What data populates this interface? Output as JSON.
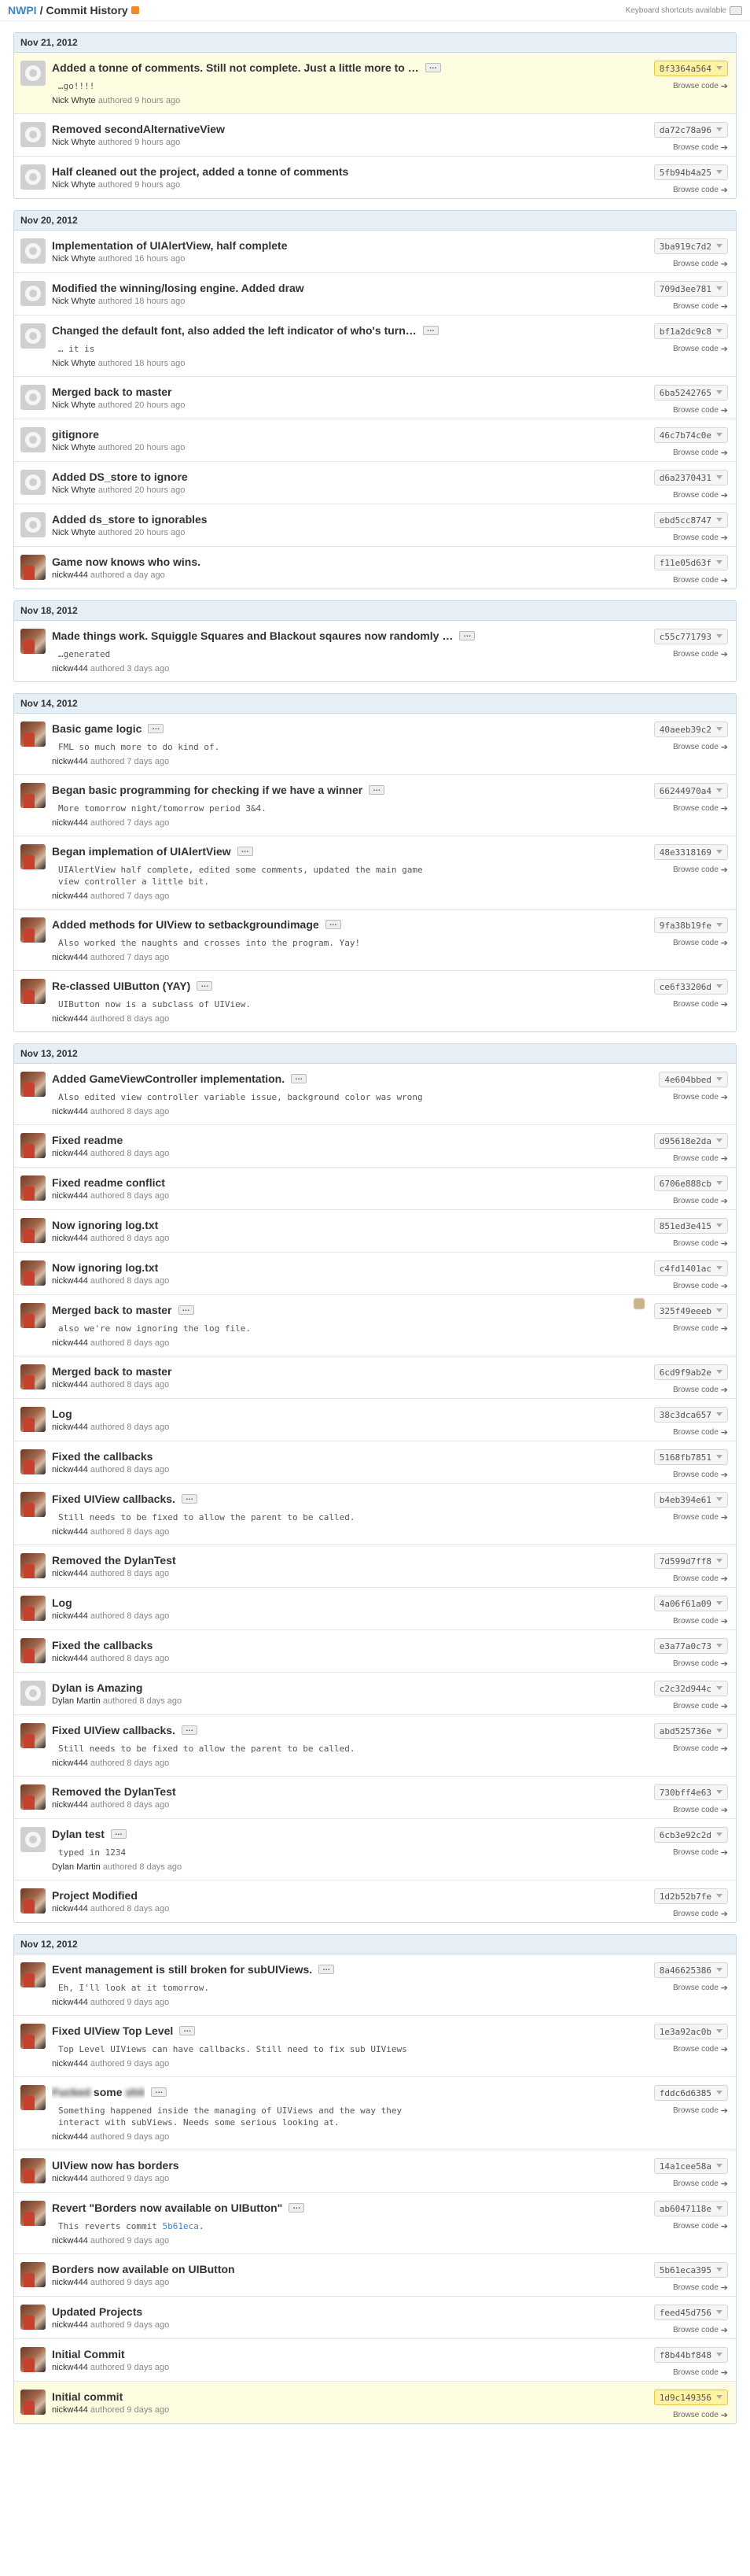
{
  "header": {
    "repo": "NWPI",
    "separator": " / ",
    "title": "Commit History",
    "shortcut_hint": "Keyboard shortcuts available",
    "rss_icon": "rss-icon",
    "keyboard_icon": "keyboard-icon"
  },
  "colors": {
    "link": "#4183c4",
    "header_bg": "#e6eff6",
    "highlight_bg": "#fffde1",
    "rss": "#f08a24"
  },
  "browse_label": "Browse code",
  "authored_label": "authored",
  "groups": [
    {
      "date": "Nov 21, 2012",
      "commits": [
        {
          "message": "Added a tonne of comments. Still not complete. Just a little more to …",
          "has_ellipsis": true,
          "description": "…go!!!!",
          "author": "Nick Whyte",
          "time": "9 hours ago",
          "sha": "8f3364a564",
          "avatar": "default",
          "highlighted": true
        },
        {
          "message": "Removed secondAlternativeView",
          "author": "Nick Whyte",
          "time": "9 hours ago",
          "sha": "da72c78a96",
          "avatar": "default"
        },
        {
          "message": "Half cleaned out the project, added a tonne of comments",
          "author": "Nick Whyte",
          "time": "9 hours ago",
          "sha": "5fb94b4a25",
          "avatar": "default"
        }
      ]
    },
    {
      "date": "Nov 20, 2012",
      "commits": [
        {
          "message": "Implementation of UIAlertView, half complete",
          "author": "Nick Whyte",
          "time": "16 hours ago",
          "sha": "3ba919c7d2",
          "avatar": "default"
        },
        {
          "message": "Modified the winning/losing engine. Added draw",
          "author": "Nick Whyte",
          "time": "18 hours ago",
          "sha": "709d3ee781",
          "avatar": "default"
        },
        {
          "message": "Changed the default font, also added the left indicator of who's turn…",
          "has_ellipsis": true,
          "description": "… it is",
          "author": "Nick Whyte",
          "time": "18 hours ago",
          "sha": "bf1a2dc9c8",
          "avatar": "default"
        },
        {
          "message": "Merged back to master",
          "author": "Nick Whyte",
          "time": "20 hours ago",
          "sha": "6ba5242765",
          "avatar": "default"
        },
        {
          "message": "gitignore",
          "author": "Nick Whyte",
          "time": "20 hours ago",
          "sha": "46c7b74c0e",
          "avatar": "default"
        },
        {
          "message": "Added DS_store to ignore",
          "author": "Nick Whyte",
          "time": "20 hours ago",
          "sha": "d6a2370431",
          "avatar": "default"
        },
        {
          "message": "Added ds_store to ignorables",
          "author": "Nick Whyte",
          "time": "20 hours ago",
          "sha": "ebd5cc8747",
          "avatar": "default"
        },
        {
          "message": "Game now knows who wins.",
          "author": "nickw444",
          "time": "a day ago",
          "sha": "f11e05d63f",
          "avatar": "custom"
        }
      ]
    },
    {
      "date": "Nov 18, 2012",
      "commits": [
        {
          "message": "Made things work. Squiggle Squares and Blackout sqaures now randomly …",
          "has_ellipsis": true,
          "description": "…generated",
          "author": "nickw444",
          "time": "3 days ago",
          "sha": "c55c771793",
          "avatar": "custom"
        }
      ]
    },
    {
      "date": "Nov 14, 2012",
      "commits": [
        {
          "message": "Basic game logic",
          "has_ellipsis": true,
          "description": "FML so much more to do kind of.",
          "author": "nickw444",
          "time": "7 days ago",
          "sha": "40aeeb39c2",
          "avatar": "custom"
        },
        {
          "message": "Began basic programming for checking if we have a winner",
          "has_ellipsis": true,
          "description": "More tomorrow night/tomorrow period 3&4.",
          "author": "nickw444",
          "time": "7 days ago",
          "sha": "66244970a4",
          "avatar": "custom"
        },
        {
          "message": "Began implemation of UIAlertView",
          "has_ellipsis": true,
          "description": "UIAlertView half complete, edited some comments, updated the main game\nview controller a little bit.",
          "author": "nickw444",
          "time": "7 days ago",
          "sha": "48e3318169",
          "avatar": "custom"
        },
        {
          "message": "Added methods for UIView to setbackgroundimage",
          "has_ellipsis": true,
          "description": "Also worked the naughts and crosses into the program. Yay!",
          "author": "nickw444",
          "time": "7 days ago",
          "sha": "9fa38b19fe",
          "avatar": "custom"
        },
        {
          "message": "Re-classed UIButton (YAY)",
          "has_ellipsis": true,
          "description": "UIButton now is a subclass of UIView.",
          "author": "nickw444",
          "time": "8 days ago",
          "sha": "ce6f33206d",
          "avatar": "custom"
        }
      ]
    },
    {
      "date": "Nov 13, 2012",
      "commits": [
        {
          "message": "Added GameViewController implementation.",
          "has_ellipsis": true,
          "description": "Also edited view controller variable issue, background color was wrong",
          "author": "nickw444",
          "time": "8 days ago",
          "sha": "4e604bbed",
          "avatar": "custom"
        },
        {
          "message": "Fixed readme",
          "author": "nickw444",
          "time": "8 days ago",
          "sha": "d95618e2da",
          "avatar": "custom"
        },
        {
          "message": "Fixed readme conflict",
          "author": "nickw444",
          "time": "8 days ago",
          "sha": "6706e888cb",
          "avatar": "custom"
        },
        {
          "message": "Now ignoring log.txt",
          "author": "nickw444",
          "time": "8 days ago",
          "sha": "851ed3e415",
          "avatar": "custom"
        },
        {
          "message": "Now ignoring log.txt",
          "author": "nickw444",
          "time": "8 days ago",
          "sha": "c4fd1401ac",
          "avatar": "custom"
        },
        {
          "message": "Merged back to master",
          "has_ellipsis": true,
          "description": "also we're now ignoring the log file.",
          "author": "nickw444",
          "time": "8 days ago",
          "sha": "325f49eeeb",
          "avatar": "custom",
          "blur_icon": true
        },
        {
          "message": "Merged back to master",
          "author": "nickw444",
          "time": "8 days ago",
          "sha": "6cd9f9ab2e",
          "avatar": "custom"
        },
        {
          "message": "Log",
          "author": "nickw444",
          "time": "8 days ago",
          "sha": "38c3dca657",
          "avatar": "custom"
        },
        {
          "message": "Fixed the callbacks",
          "author": "nickw444",
          "time": "8 days ago",
          "sha": "5168fb7851",
          "avatar": "custom"
        },
        {
          "message": "Fixed UIView callbacks.",
          "has_ellipsis": true,
          "description": "Still needs to be fixed to allow the parent to be called.",
          "author": "nickw444",
          "time": "8 days ago",
          "sha": "b4eb394e61",
          "avatar": "custom"
        },
        {
          "message": "Removed the DylanTest",
          "author": "nickw444",
          "time": "8 days ago",
          "sha": "7d599d7ff8",
          "avatar": "custom"
        },
        {
          "message": "Log",
          "author": "nickw444",
          "time": "8 days ago",
          "sha": "4a06f61a09",
          "avatar": "custom"
        },
        {
          "message": "Fixed the callbacks",
          "author": "nickw444",
          "time": "8 days ago",
          "sha": "e3a77a0c73",
          "avatar": "custom"
        },
        {
          "message": "Dylan is Amazing",
          "author": "Dylan Martin",
          "time": "8 days ago",
          "sha": "c2c32d944c",
          "avatar": "default"
        },
        {
          "message": "Fixed UIView callbacks.",
          "has_ellipsis": true,
          "description": "Still needs to be fixed to allow the parent to be called.",
          "author": "nickw444",
          "time": "8 days ago",
          "sha": "abd525736e",
          "avatar": "custom"
        },
        {
          "message": "Removed the DylanTest",
          "author": "nickw444",
          "time": "8 days ago",
          "sha": "730bff4e63",
          "avatar": "custom"
        },
        {
          "message": "Dylan test",
          "has_ellipsis": true,
          "description": "typed in 1234",
          "author": "Dylan Martin",
          "time": "8 days ago",
          "sha": "6cb3e92c2d",
          "avatar": "default"
        },
        {
          "message": "Project Modified",
          "author": "nickw444",
          "time": "8 days ago",
          "sha": "1d2b52b7fe",
          "avatar": "custom"
        }
      ]
    },
    {
      "date": "Nov 12, 2012",
      "commits": [
        {
          "message": "Event management is still broken for subUIViews.",
          "has_ellipsis": true,
          "description": "Eh, I'll look at it tomorrow.",
          "author": "nickw444",
          "time": "9 days ago",
          "sha": "8a46625386",
          "avatar": "custom"
        },
        {
          "message": "Fixed UIView Top Level",
          "has_ellipsis": true,
          "description": "Top Level UIViews can have callbacks. Still need to fix sub UIViews",
          "author": "nickw444",
          "time": "9 days ago",
          "sha": "1e3a92ac0b",
          "avatar": "custom"
        },
        {
          "message_blur_a": "Fucked",
          "message_mid": " some ",
          "message_blur_b": "shit",
          "has_ellipsis": true,
          "blurred_title": true,
          "description": "Something happened inside the managing of UIViews and the way they\ninteract with subViews. Needs some serious looking at.",
          "author": "nickw444",
          "time": "9 days ago",
          "sha": "fddc6d6385",
          "avatar": "custom"
        },
        {
          "message": "UIView now has borders",
          "author": "nickw444",
          "time": "9 days ago",
          "sha": "14a1cee58a",
          "avatar": "custom"
        },
        {
          "message": "Revert \"Borders now available on UIButton\"",
          "has_ellipsis": true,
          "description": "This reverts commit ",
          "description_link": "5b61eca",
          "description_tail": ".",
          "author": "nickw444",
          "time": "9 days ago",
          "sha": "ab6047118e",
          "avatar": "custom"
        },
        {
          "message": "Borders now available on UIButton",
          "author": "nickw444",
          "time": "9 days ago",
          "sha": "5b61eca395",
          "avatar": "custom"
        },
        {
          "message": "Updated Projects",
          "author": "nickw444",
          "time": "9 days ago",
          "sha": "feed45d756",
          "avatar": "custom"
        },
        {
          "message": "Initial Commit",
          "author": "nickw444",
          "time": "9 days ago",
          "sha": "f8b44bf848",
          "avatar": "custom"
        },
        {
          "message": "Initial commit",
          "author": "nickw444",
          "time": "9 days ago",
          "sha": "1d9c149356",
          "avatar": "custom",
          "highlighted": true
        }
      ]
    }
  ]
}
